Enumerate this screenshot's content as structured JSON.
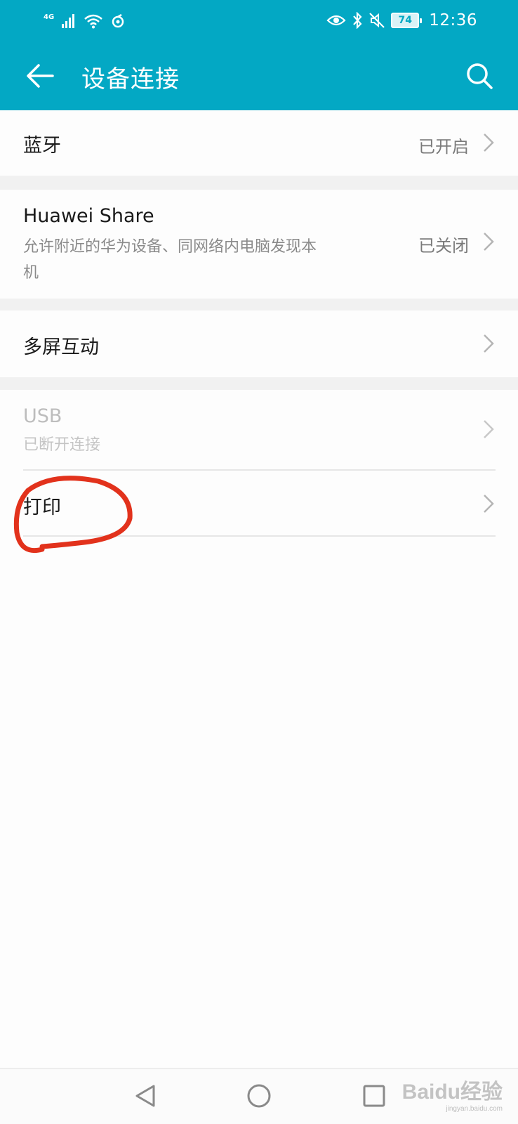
{
  "status_bar": {
    "network": "4G",
    "time": "12:36",
    "battery": "74",
    "icons": [
      "signal-icon",
      "wifi-icon",
      "sync-icon",
      "eye-comfort-icon",
      "bluetooth-icon",
      "mute-icon",
      "battery-icon"
    ]
  },
  "header": {
    "title": "设备连接",
    "back_icon": "arrow-left-icon",
    "search_icon": "search-icon",
    "background": "#03a8c4"
  },
  "items": [
    {
      "title": "蓝牙",
      "status": "已开启"
    },
    {
      "title": "Huawei Share",
      "subtitle": "允许附近的华为设备、同网络内电脑发现本机",
      "status": "已关闭"
    },
    {
      "title": "多屏互动"
    },
    {
      "title": "USB",
      "subtitle": "已断开连接",
      "disabled": true
    },
    {
      "title": "打印"
    }
  ],
  "nav_bar": {
    "icons": [
      "back-triangle-icon",
      "home-circle-icon",
      "recents-square-icon"
    ]
  },
  "watermark": {
    "brand": "Baidu经验",
    "url": "jingyan.baidu.com"
  },
  "annotation_color": "#e2321c"
}
